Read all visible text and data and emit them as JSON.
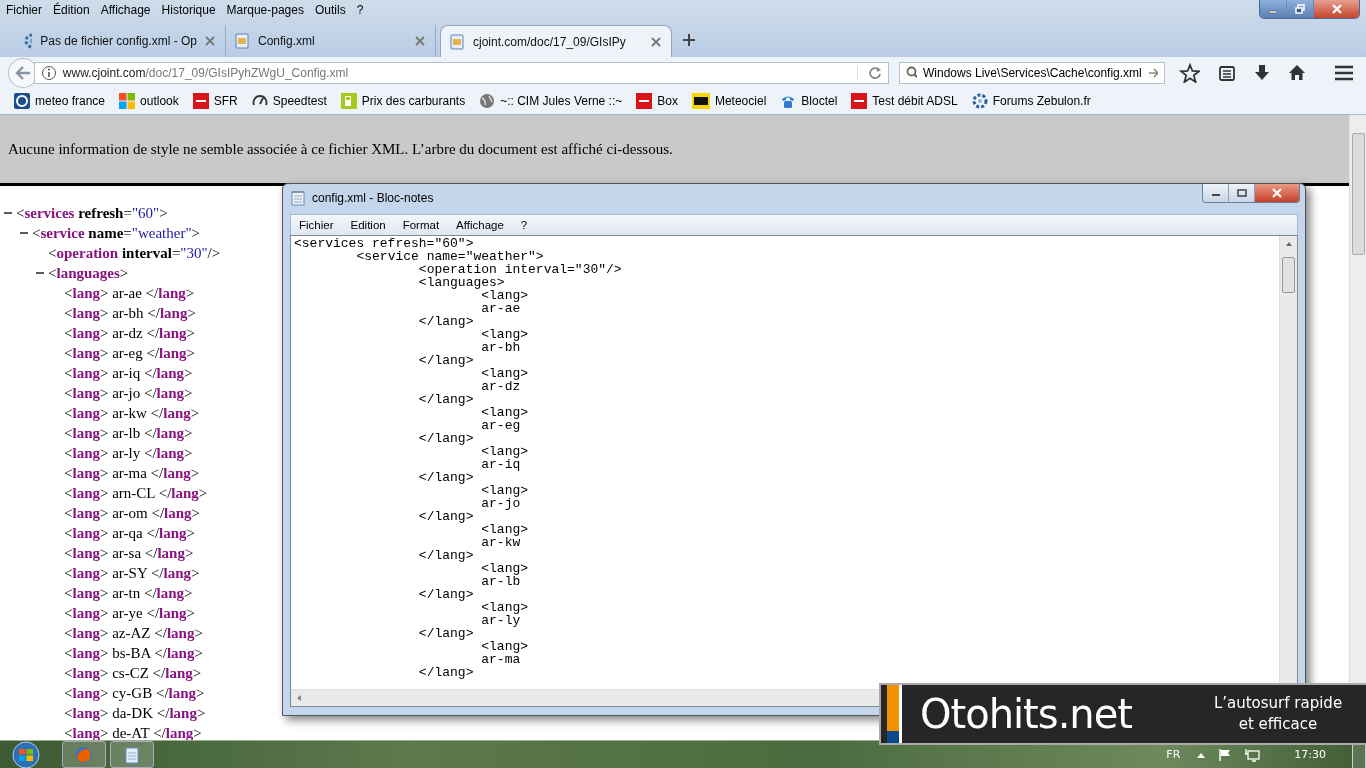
{
  "menu_bar": [
    "Fichier",
    "Édition",
    "Affichage",
    "Historique",
    "Marque-pages",
    "Outils",
    "?"
  ],
  "tabs": [
    {
      "title": "Pas de fichier config.xml - Op",
      "kind": "gear",
      "selected": false
    },
    {
      "title": "Config.xml",
      "kind": "document",
      "selected": false
    },
    {
      "title": "cjoint.com/doc/17_09/GIsIPy",
      "kind": "document",
      "selected": true
    }
  ],
  "address_bar": {
    "host": "www.cjoint.com",
    "path": "/doc/17_09/GIsIPyhZWgU_Config.xml"
  },
  "search_bar": {
    "value": "Windows Live\\Services\\Cache\\config.xml"
  },
  "bookmarks": [
    {
      "label": "meteo france",
      "kind": "weather"
    },
    {
      "label": "outlook",
      "kind": "windows"
    },
    {
      "label": "SFR",
      "kind": "red"
    },
    {
      "label": "Speedtest",
      "kind": "gauge"
    },
    {
      "label": "Prix des carburants",
      "kind": "pump"
    },
    {
      "label": "~:: CIM Jules Verne ::~",
      "kind": "globe"
    },
    {
      "label": "Box",
      "kind": "red"
    },
    {
      "label": "Meteociel",
      "kind": "yellow"
    },
    {
      "label": "Bloctel",
      "kind": "phone"
    },
    {
      "label": "Test débit ADSL",
      "kind": "red"
    },
    {
      "label": "Forums Zebulon.fr",
      "kind": "gear"
    }
  ],
  "info_bar": "Aucune information de style ne semble associée à ce fichier XML. L’arbre du document est affiché ci-dessous.",
  "xml_tree": {
    "kind": "element",
    "expanded": true,
    "start": "<",
    "tag": "services",
    "attributes": [
      {
        "name": "refresh",
        "equals": "=",
        "value": "\"60\""
      }
    ],
    "end": ">",
    "children": [
      {
        "kind": "element",
        "expanded": true,
        "start": "<",
        "tag": "service",
        "attributes": [
          {
            "name": "name",
            "equals": "=",
            "value": "\"weather\""
          }
        ],
        "end": ">",
        "children": [
          {
            "kind": "element",
            "start": "<",
            "tag": "operation",
            "attributes": [
              {
                "name": "interval",
                "equals": "=",
                "value": "\"30\""
              }
            ],
            "end": "/>"
          },
          {
            "kind": "element",
            "expanded": true,
            "start": "<",
            "tag": "languages",
            "end": ">",
            "children": [
              {
                "kind": "leaf",
                "markup": "<**lang**> ar-ae </**lang**>"
              },
              {
                "kind": "leaf",
                "markup": "<**lang**> ar-bh </**lang**>"
              },
              {
                "kind": "leaf",
                "markup": "<**lang**> ar-dz </**lang**>"
              },
              {
                "kind": "leaf",
                "markup": "<**lang**> ar-eg </**lang**>"
              },
              {
                "kind": "leaf",
                "markup": "<**lang**> ar-iq </**lang**>"
              },
              {
                "kind": "leaf",
                "markup": "<**lang**> ar-jo </**lang**>"
              },
              {
                "kind": "leaf",
                "markup": "<**lang**> ar-kw </**lang**>"
              },
              {
                "kind": "leaf",
                "markup": "<**lang**> ar-lb </**lang**>"
              },
              {
                "kind": "leaf",
                "markup": "<**lang**> ar-ly </**lang**>"
              },
              {
                "kind": "leaf",
                "markup": "<**lang**> ar-ma </**lang**>"
              },
              {
                "kind": "leaf",
                "markup": "<**lang**> arn-CL </**lang**>"
              },
              {
                "kind": "leaf",
                "markup": "<**lang**> ar-om </**lang**>"
              },
              {
                "kind": "leaf",
                "markup": "<**lang**> ar-qa </**lang**>"
              },
              {
                "kind": "leaf",
                "markup": "<**lang**> ar-sa </**lang**>"
              },
              {
                "kind": "leaf",
                "markup": "<**lang**> ar-SY </**lang**>"
              },
              {
                "kind": "leaf",
                "markup": "<**lang**> ar-tn </**lang**>"
              },
              {
                "kind": "leaf",
                "markup": "<**lang**> ar-ye </**lang**>"
              },
              {
                "kind": "leaf",
                "markup": "<**lang**> az-AZ </**lang**>"
              },
              {
                "kind": "leaf",
                "markup": "<**lang**> bs-BA </**lang**>"
              },
              {
                "kind": "leaf",
                "markup": "<**lang**> cs-CZ </**lang**>"
              },
              {
                "kind": "leaf",
                "markup": "<**lang**> cy-GB </**lang**>"
              },
              {
                "kind": "leaf",
                "markup": "<**lang**> da-DK </**lang**>"
              },
              {
                "kind": "leaf",
                "markup": "<**lang**> de-AT </**lang**>"
              }
            ]
          }
        ]
      }
    ]
  },
  "notepad": {
    "title": "config.xml - Bloc-notes",
    "menu": [
      "Fichier",
      "Edition",
      "Format",
      "Affichage",
      "?"
    ],
    "lines": [
      "<services refresh=\"60\">",
      "\t<service name=\"weather\">",
      "\t\t<operation interval=\"30\"/>",
      "\t\t<languages>",
      "\t\t\t<lang>",
      "\t\t\tar-ae",
      "\t\t</lang>",
      "\t\t\t<lang>",
      "\t\t\tar-bh",
      "\t\t</lang>",
      "\t\t\t<lang>",
      "\t\t\tar-dz",
      "\t\t</lang>",
      "\t\t\t<lang>",
      "\t\t\tar-eg",
      "\t\t</lang>",
      "\t\t\t<lang>",
      "\t\t\tar-iq",
      "\t\t</lang>",
      "\t\t\t<lang>",
      "\t\t\tar-jo",
      "\t\t</lang>",
      "\t\t\t<lang>",
      "\t\t\tar-kw",
      "\t\t</lang>",
      "\t\t\t<lang>",
      "\t\t\tar-lb",
      "\t\t</lang>",
      "\t\t\t<lang>",
      "\t\t\tar-ly",
      "\t\t</lang>",
      "\t\t\t<lang>",
      "\t\t\tar-ma",
      "\t\t</lang>"
    ]
  },
  "notification": {
    "brand": "Otohits.net",
    "tagline": "L’autosurf rapide et efficace"
  },
  "taskbar": {
    "language": "FR",
    "time": "17:30"
  }
}
